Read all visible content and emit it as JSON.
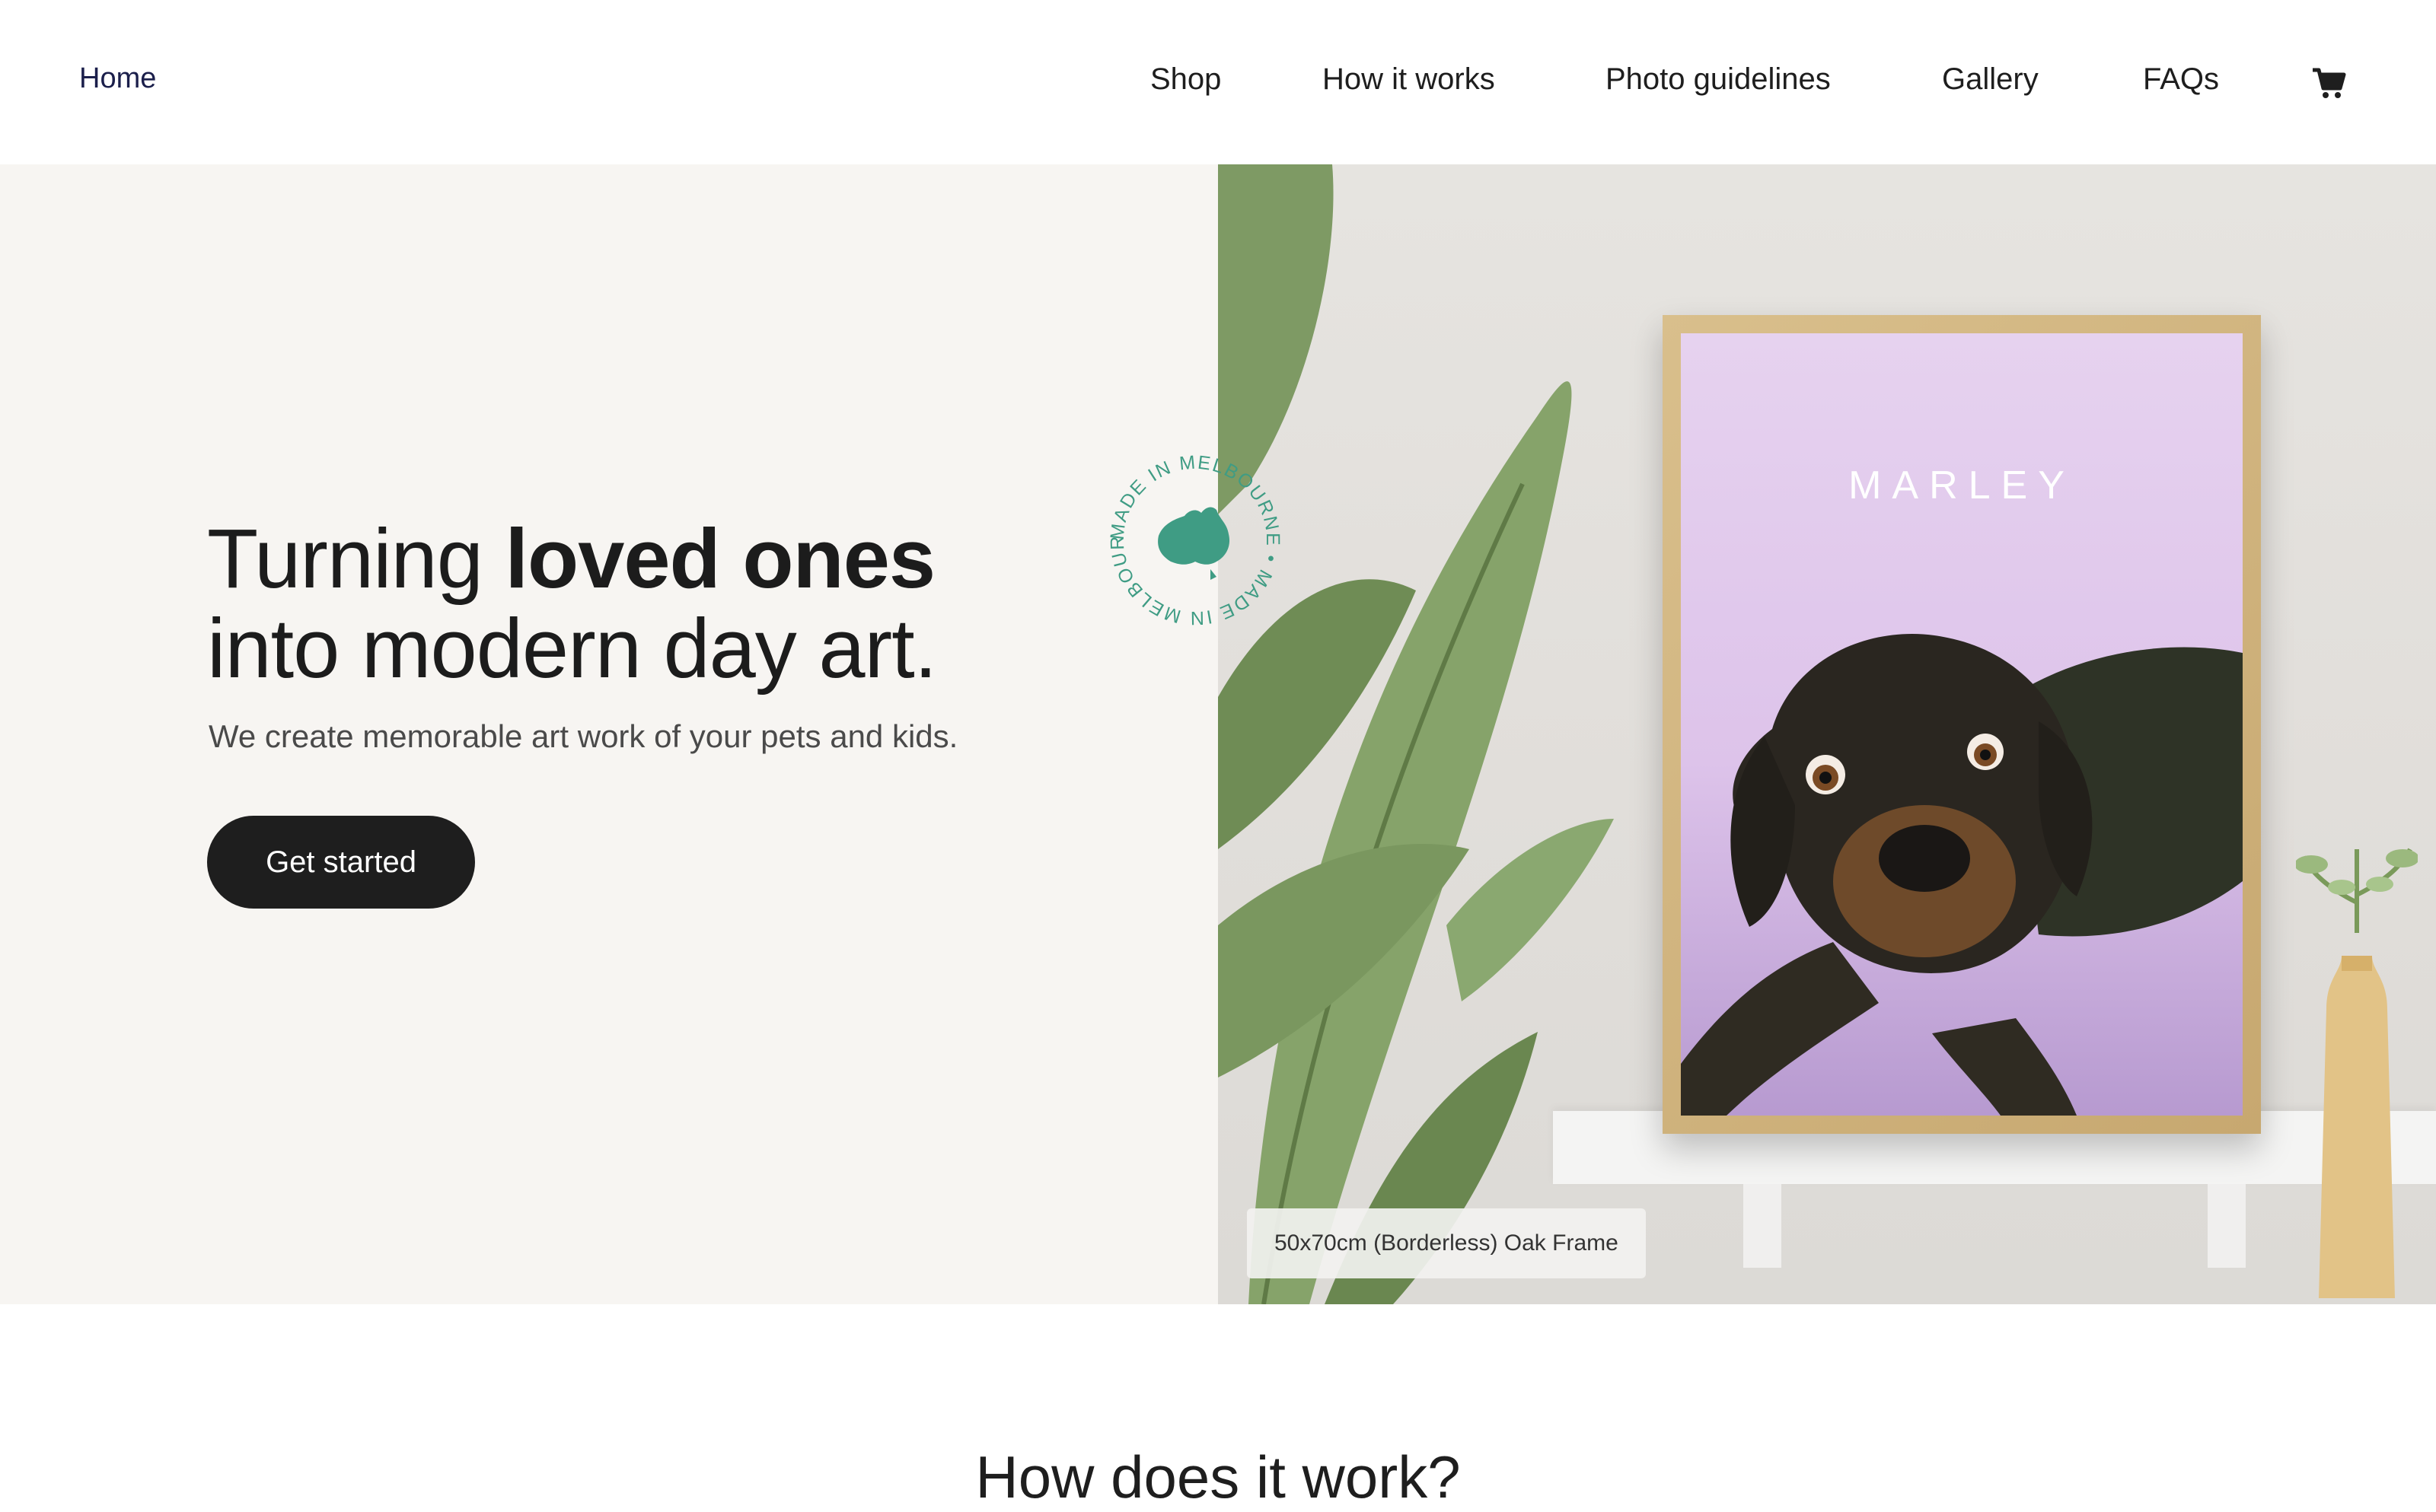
{
  "header": {
    "home_label": "Home",
    "nav": [
      {
        "label": "Shop"
      },
      {
        "label": "How it works"
      },
      {
        "label": "Photo guidelines"
      },
      {
        "label": "Gallery"
      },
      {
        "label": "FAQs"
      }
    ],
    "cart_icon": "shopping-cart-icon"
  },
  "hero": {
    "headline_line1_regular": "Turning ",
    "headline_line1_bold": "loved ones",
    "headline_line2": "into modern day art.",
    "subheading": "We create memorable art work of your pets and kids.",
    "cta_label": "Get started",
    "badge_text": "MADE IN MELBOURNE • MADE IN MELBOURNE •",
    "poster_name": "MARLEY",
    "product_caption": "50x70cm (Borderless) Oak Frame"
  },
  "section": {
    "title": "How does it work?"
  },
  "colors": {
    "accent_dark": "#1e1e1e",
    "home_link": "#1b1f4b",
    "badge_green": "#3f9c84",
    "hero_left_bg": "#f7f5f2",
    "poster_lilac": "#e3cdee"
  }
}
